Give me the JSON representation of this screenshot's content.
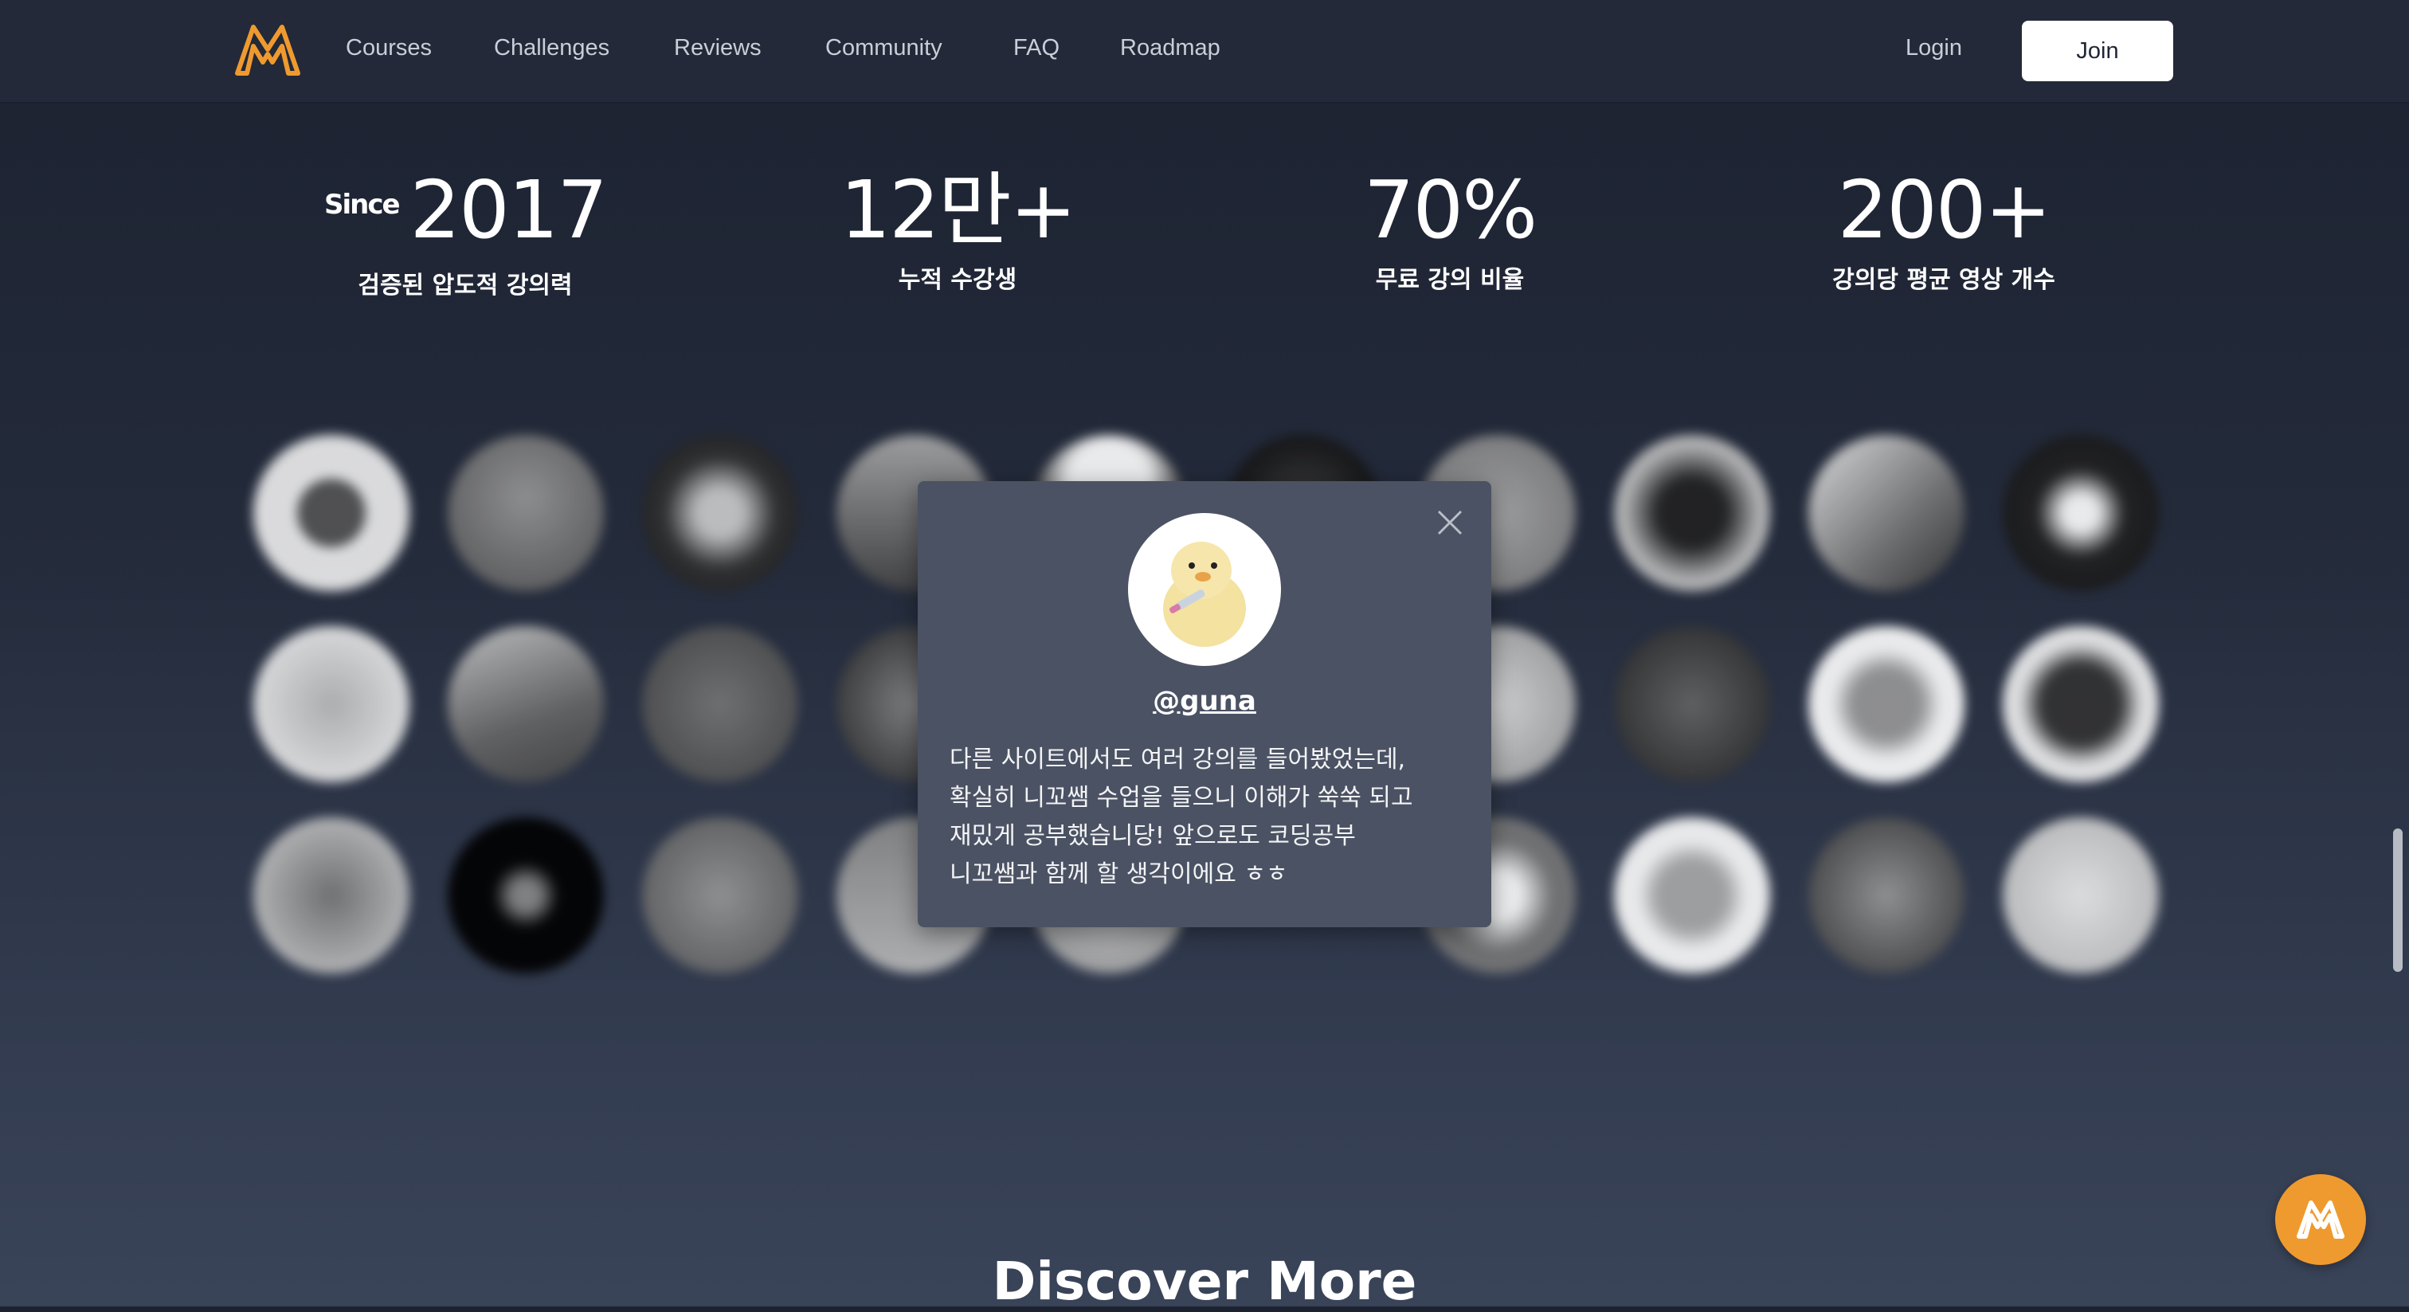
{
  "nav": {
    "links": [
      "Courses",
      "Challenges",
      "Reviews",
      "Community",
      "FAQ",
      "Roadmap"
    ],
    "login": "Login",
    "join": "Join"
  },
  "stats": [
    {
      "prefix": "Since",
      "value": "2017",
      "label": "검증된 압도적 강의력"
    },
    {
      "prefix": "",
      "value": "12만+",
      "label": "누적 수강생"
    },
    {
      "prefix": "",
      "value": "70%",
      "label": "무료 강의 비율"
    },
    {
      "prefix": "",
      "value": "200+",
      "label": "강의당 평균 영상 개수"
    }
  ],
  "modal": {
    "username": "@guna",
    "review_lines": [
      "다른 사이트에서도 여러 강의를 들어봤었는데,",
      "확실히 니꼬쌤 수업을 들으니 이해가 쑥쑥 되고",
      "재밌게 공부했습니당! 앞으로도 코딩공부",
      "니꼬쌤과 함께 할 생각이에요 ㅎㅎ"
    ]
  },
  "discover": "Discover More",
  "colors": {
    "brand": "#ef9a2f",
    "nav_bg": "#232938",
    "modal_bg": "#4b5263"
  }
}
